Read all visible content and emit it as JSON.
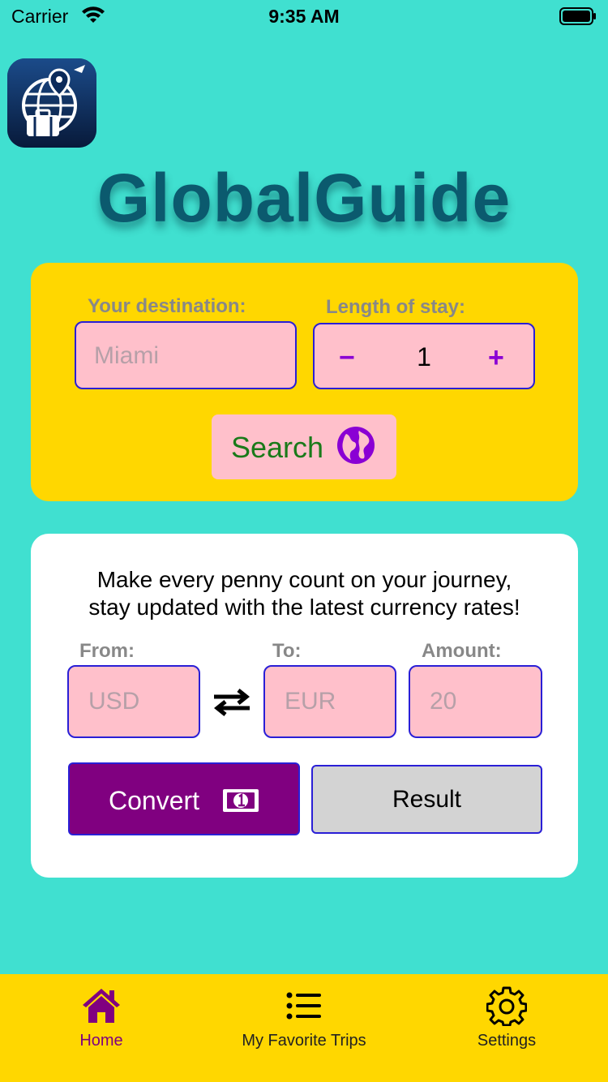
{
  "status_bar": {
    "carrier": "Carrier",
    "time": "9:35 AM"
  },
  "app": {
    "title": "GlobalGuide",
    "icon": "globe-suitcase-location-icon"
  },
  "search_card": {
    "destination_label": "Your destination:",
    "destination_placeholder": "Miami",
    "stay_label": "Length of stay:",
    "stay_value": "1",
    "minus_symbol": "−",
    "plus_symbol": "+",
    "search_label": "Search",
    "search_icon": "globe-icon"
  },
  "currency_card": {
    "tagline_line1": "Make every penny count on your journey,",
    "tagline_line2": "stay updated with the latest currency rates!",
    "from_label": "From:",
    "to_label": "To:",
    "amount_label": "Amount:",
    "from_placeholder": "USD",
    "to_placeholder": "EUR",
    "amount_placeholder": "20",
    "convert_label": "Convert",
    "result_label": "Result"
  },
  "tab_bar": {
    "tabs": [
      {
        "label": "Home",
        "icon": "house-icon",
        "active": true
      },
      {
        "label": "My Favorite Trips",
        "icon": "list-icon",
        "active": false
      },
      {
        "label": "Settings",
        "icon": "gear-icon",
        "active": false
      }
    ]
  },
  "colors": {
    "background": "#40e0d0",
    "card_yellow": "#ffd700",
    "field_pink": "#ffc0cb",
    "field_border": "#2a1fd6",
    "accent_purple": "#800080",
    "title_color": "#0b5a6e"
  }
}
